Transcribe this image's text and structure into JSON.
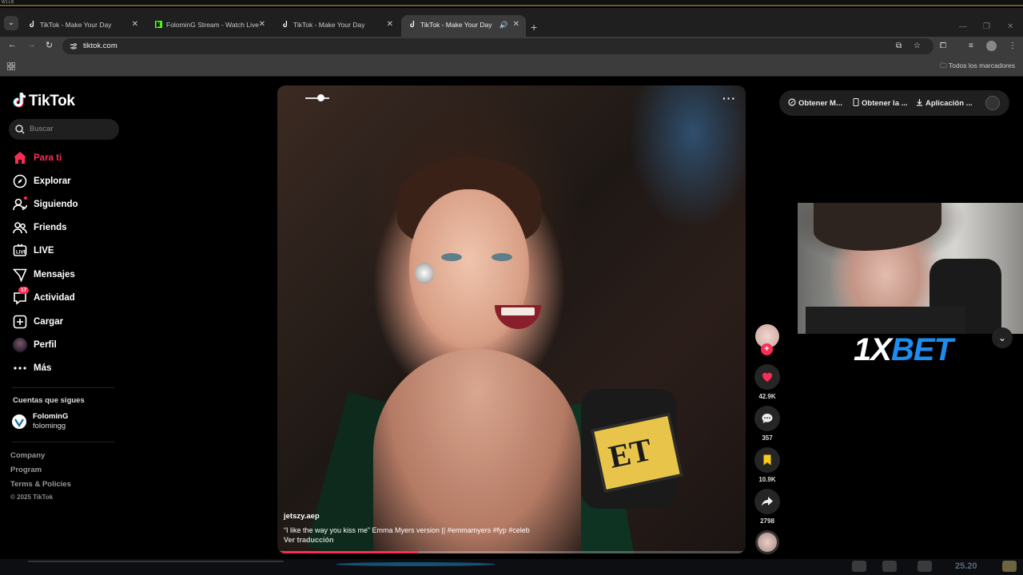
{
  "browser": {
    "top_strip_text": "W1-LB",
    "tabs": [
      {
        "title": "TikTok - Make Your Day",
        "active": false
      },
      {
        "title": "FolominG Stream - Watch Live",
        "active": false
      },
      {
        "title": "TikTok - Make Your Day",
        "active": false
      },
      {
        "title": "TikTok - Make Your Day",
        "active": true
      }
    ],
    "url": "tiktok.com",
    "bookmarks_label": "Todos los marcadores"
  },
  "sidebar": {
    "logo_text": "TikTok",
    "search_placeholder": "Buscar",
    "nav": [
      {
        "label": "Para ti",
        "icon": "home-icon",
        "active": true
      },
      {
        "label": "Explorar",
        "icon": "compass-icon"
      },
      {
        "label": "Siguiendo",
        "icon": "following-icon"
      },
      {
        "label": "Friends",
        "icon": "friends-icon"
      },
      {
        "label": "LIVE",
        "icon": "live-icon"
      },
      {
        "label": "Mensajes",
        "icon": "messages-icon"
      },
      {
        "label": "Actividad",
        "icon": "activity-icon",
        "badge": "17"
      },
      {
        "label": "Cargar",
        "icon": "upload-icon"
      },
      {
        "label": "Perfil",
        "icon": "profile-avatar"
      },
      {
        "label": "Más",
        "icon": "more-icon"
      }
    ],
    "following_title": "Cuentas que sigues",
    "following": [
      {
        "name": "FolominG",
        "username": "folomingg"
      }
    ],
    "footer": [
      "Company",
      "Program",
      "Terms & Policies"
    ],
    "copyright": "© 2025 TikTok"
  },
  "video": {
    "username": "jetszy.aep",
    "description": "“I like the way you kiss me” Emma Myers version || #emmamyers  #fyp  #celeb",
    "translate_label": "Ver traducción",
    "mic_logo_text": "ET",
    "progress": 0.3
  },
  "actions": {
    "likes": "42.9K",
    "comments": "357",
    "saves": "10.9K",
    "shares": "2798"
  },
  "header": {
    "items": [
      "Obtener M...",
      "Obtener la ...",
      "Aplicación ..."
    ]
  },
  "overlay": {
    "sponsor_white": "1X",
    "sponsor_blue": "BET"
  },
  "taskbar": {
    "clock": "25.20"
  },
  "colors": {
    "accent": "#fe2c55",
    "bookmark": "#facc15",
    "sponsor_blue": "#1b8df0"
  }
}
